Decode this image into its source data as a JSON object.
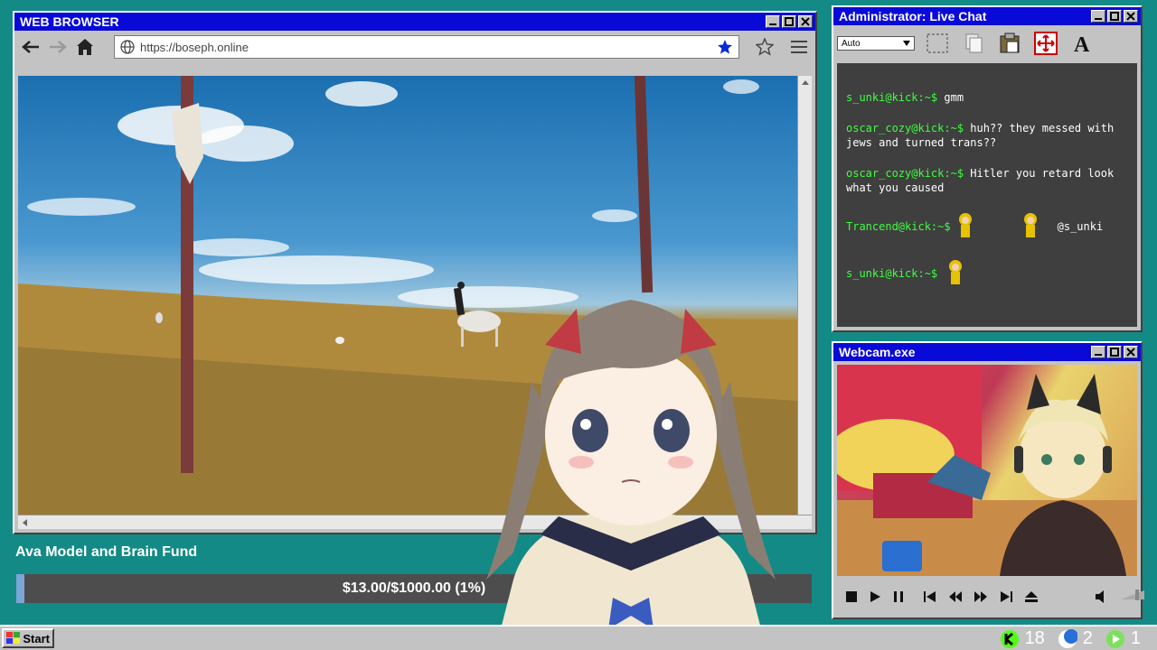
{
  "browser": {
    "title": "WEB BROWSER",
    "url": "https://boseph.online"
  },
  "chat": {
    "title": "Administrator: Live Chat",
    "font_select": "Auto",
    "messages": [
      {
        "user": "s_unki@kick:~$",
        "text": "gmm"
      },
      {
        "user": "oscar_cozy@kick:~$",
        "text": "huh?? they messed with jews and turned trans??"
      },
      {
        "user": "oscar_cozy@kick:~$",
        "text": "Hitler you retard look what you caused"
      },
      {
        "user": "Trancend@kick:~$",
        "text": "@s_unki"
      },
      {
        "user": "s_unki@kick:~$",
        "text": ""
      }
    ]
  },
  "webcam": {
    "title": "Webcam.exe"
  },
  "fund": {
    "title": "Ava Model and Brain Fund",
    "progress_text": "$13.00/$1000.00 (1%)",
    "raised": 13.0,
    "goal": 1000.0,
    "percent": 1
  },
  "taskbar": {
    "start_label": "Start",
    "tray_count_1": "18",
    "tray_count_2": "2",
    "tray_count_3": "1"
  },
  "colors": {
    "desktop": "#138a86",
    "titlebar": "#0a0ad8",
    "chat_user": "#3dff3d"
  }
}
